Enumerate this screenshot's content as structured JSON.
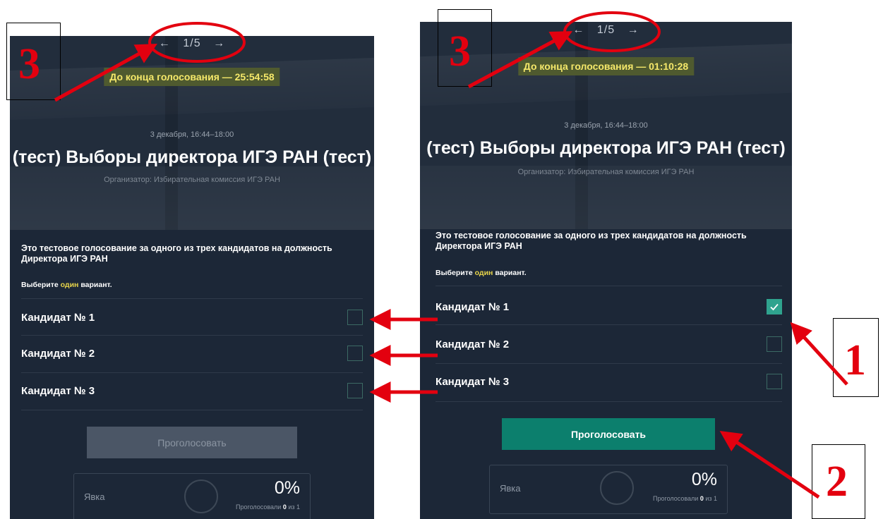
{
  "voting": {
    "pager": {
      "prev_icon": "←",
      "position": "1/5",
      "next_icon": "→"
    },
    "date": "3 декабря, 16:44–18:00",
    "title": "(тест) Выборы директора ИГЭ РАН (тест)",
    "organizer": "Организатор: Избирательная комиссия ИГЭ РАН",
    "description": "Это тестовое голосование за одного из трех кандидатов на должность Директора ИГЭ РАН",
    "choose_prefix": "Выберите ",
    "choose_highlight": "один",
    "choose_suffix": " вариант.",
    "candidates": [
      "Кандидат № 1",
      "Кандидат № 2",
      "Кандидат № 3"
    ],
    "vote_button": "Проголосовать",
    "turnout": {
      "label": "Явка",
      "percent": "0%",
      "voted_prefix": "Проголосовали ",
      "voted_count": "0",
      "voted_of": " из ",
      "voted_total": "1"
    }
  },
  "left_screen": {
    "timer": "До конца голосования — 25:54:58",
    "selected": [],
    "vote_enabled": false
  },
  "right_screen": {
    "timer": "До конца голосования — 01:10:28",
    "selected": [
      1
    ],
    "vote_enabled": true
  },
  "callouts": {
    "one": "1",
    "two": "2",
    "three": "3"
  },
  "colors": {
    "panel_bg": "#1c2737",
    "timer_bg": "#4f5a2f",
    "timer_text": "#f5e86a",
    "highlight": "#e7d44a",
    "checkbox_checked": "#2fa38e",
    "vote_active": "#0c7f6d",
    "vote_disabled": "#4b5666",
    "annotation_red": "#e3000f"
  },
  "icons": {
    "check": "check-icon",
    "prev": "arrow-left-icon",
    "next": "arrow-right-icon"
  }
}
